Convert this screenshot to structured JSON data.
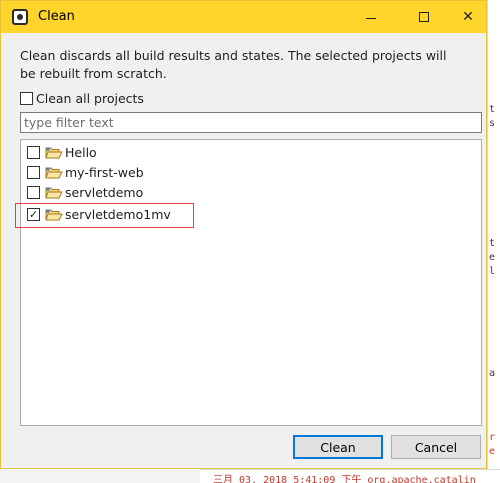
{
  "window": {
    "title": "Clean"
  },
  "dialog": {
    "description": "Clean discards all build results and states. The selected projects will be rebuilt from scratch.",
    "clean_all_label": "Clean all projects",
    "clean_all_checked": false,
    "filter_placeholder": "type filter text",
    "filter_value": "",
    "projects": [
      {
        "name": "Hello",
        "checked": false
      },
      {
        "name": "my-first-web",
        "checked": false
      },
      {
        "name": "servletdemo",
        "checked": false
      },
      {
        "name": "servletdemo1mv",
        "checked": true
      }
    ],
    "buttons": {
      "clean": "Clean",
      "cancel": "Cancel"
    }
  },
  "background_console": {
    "bottom_line": "三月 03, 2018 5:41:09 下午 org.apache.catalin"
  },
  "colors": {
    "titlebar": "#ffd52b",
    "annotation_box": "#e04040",
    "default_button_border": "#0078d7"
  }
}
